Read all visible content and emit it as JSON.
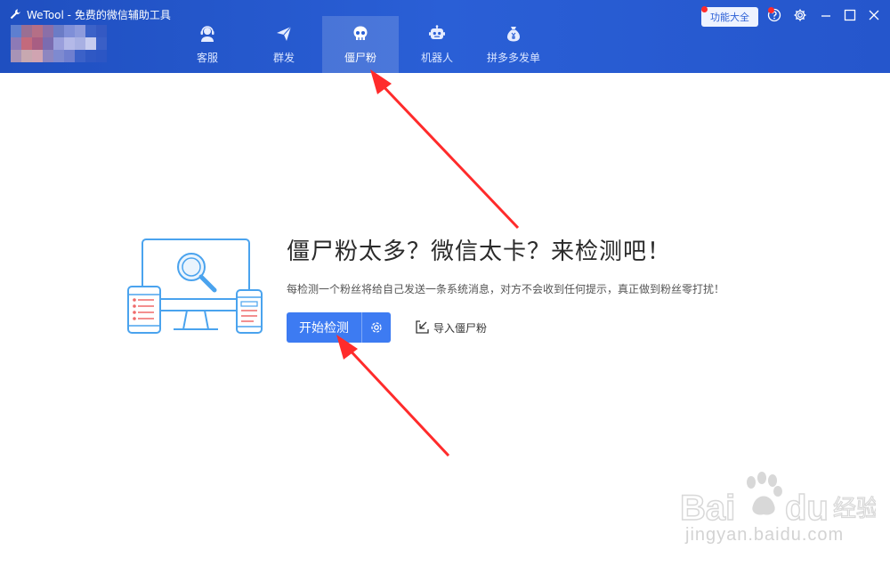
{
  "window": {
    "title": "WeTool - 免费的微信辅助工具",
    "feature_button": "功能大全"
  },
  "tabs": [
    {
      "label": "客服",
      "icon": "customer-service-icon",
      "active": false
    },
    {
      "label": "群发",
      "icon": "paper-plane-icon",
      "active": false
    },
    {
      "label": "僵尸粉",
      "icon": "skull-icon",
      "active": true
    },
    {
      "label": "机器人",
      "icon": "robot-icon",
      "active": false
    },
    {
      "label": "拼多多发单",
      "icon": "money-bag-icon",
      "active": false
    }
  ],
  "main": {
    "headline": "僵尸粉太多？微信太卡？来检测吧！",
    "subline": "每检测一个粉丝将给自己发送一条系统消息，对方不会收到任何提示，真正做到粉丝零打扰！",
    "start_button": "开始检测",
    "import_link": "导入僵尸粉"
  },
  "watermark": {
    "text": "jingyan.baidu.com"
  },
  "colors": {
    "titlebar": "#2556cc",
    "accent": "#3d7bf2",
    "annotation_arrow": "#ff2b2b"
  }
}
